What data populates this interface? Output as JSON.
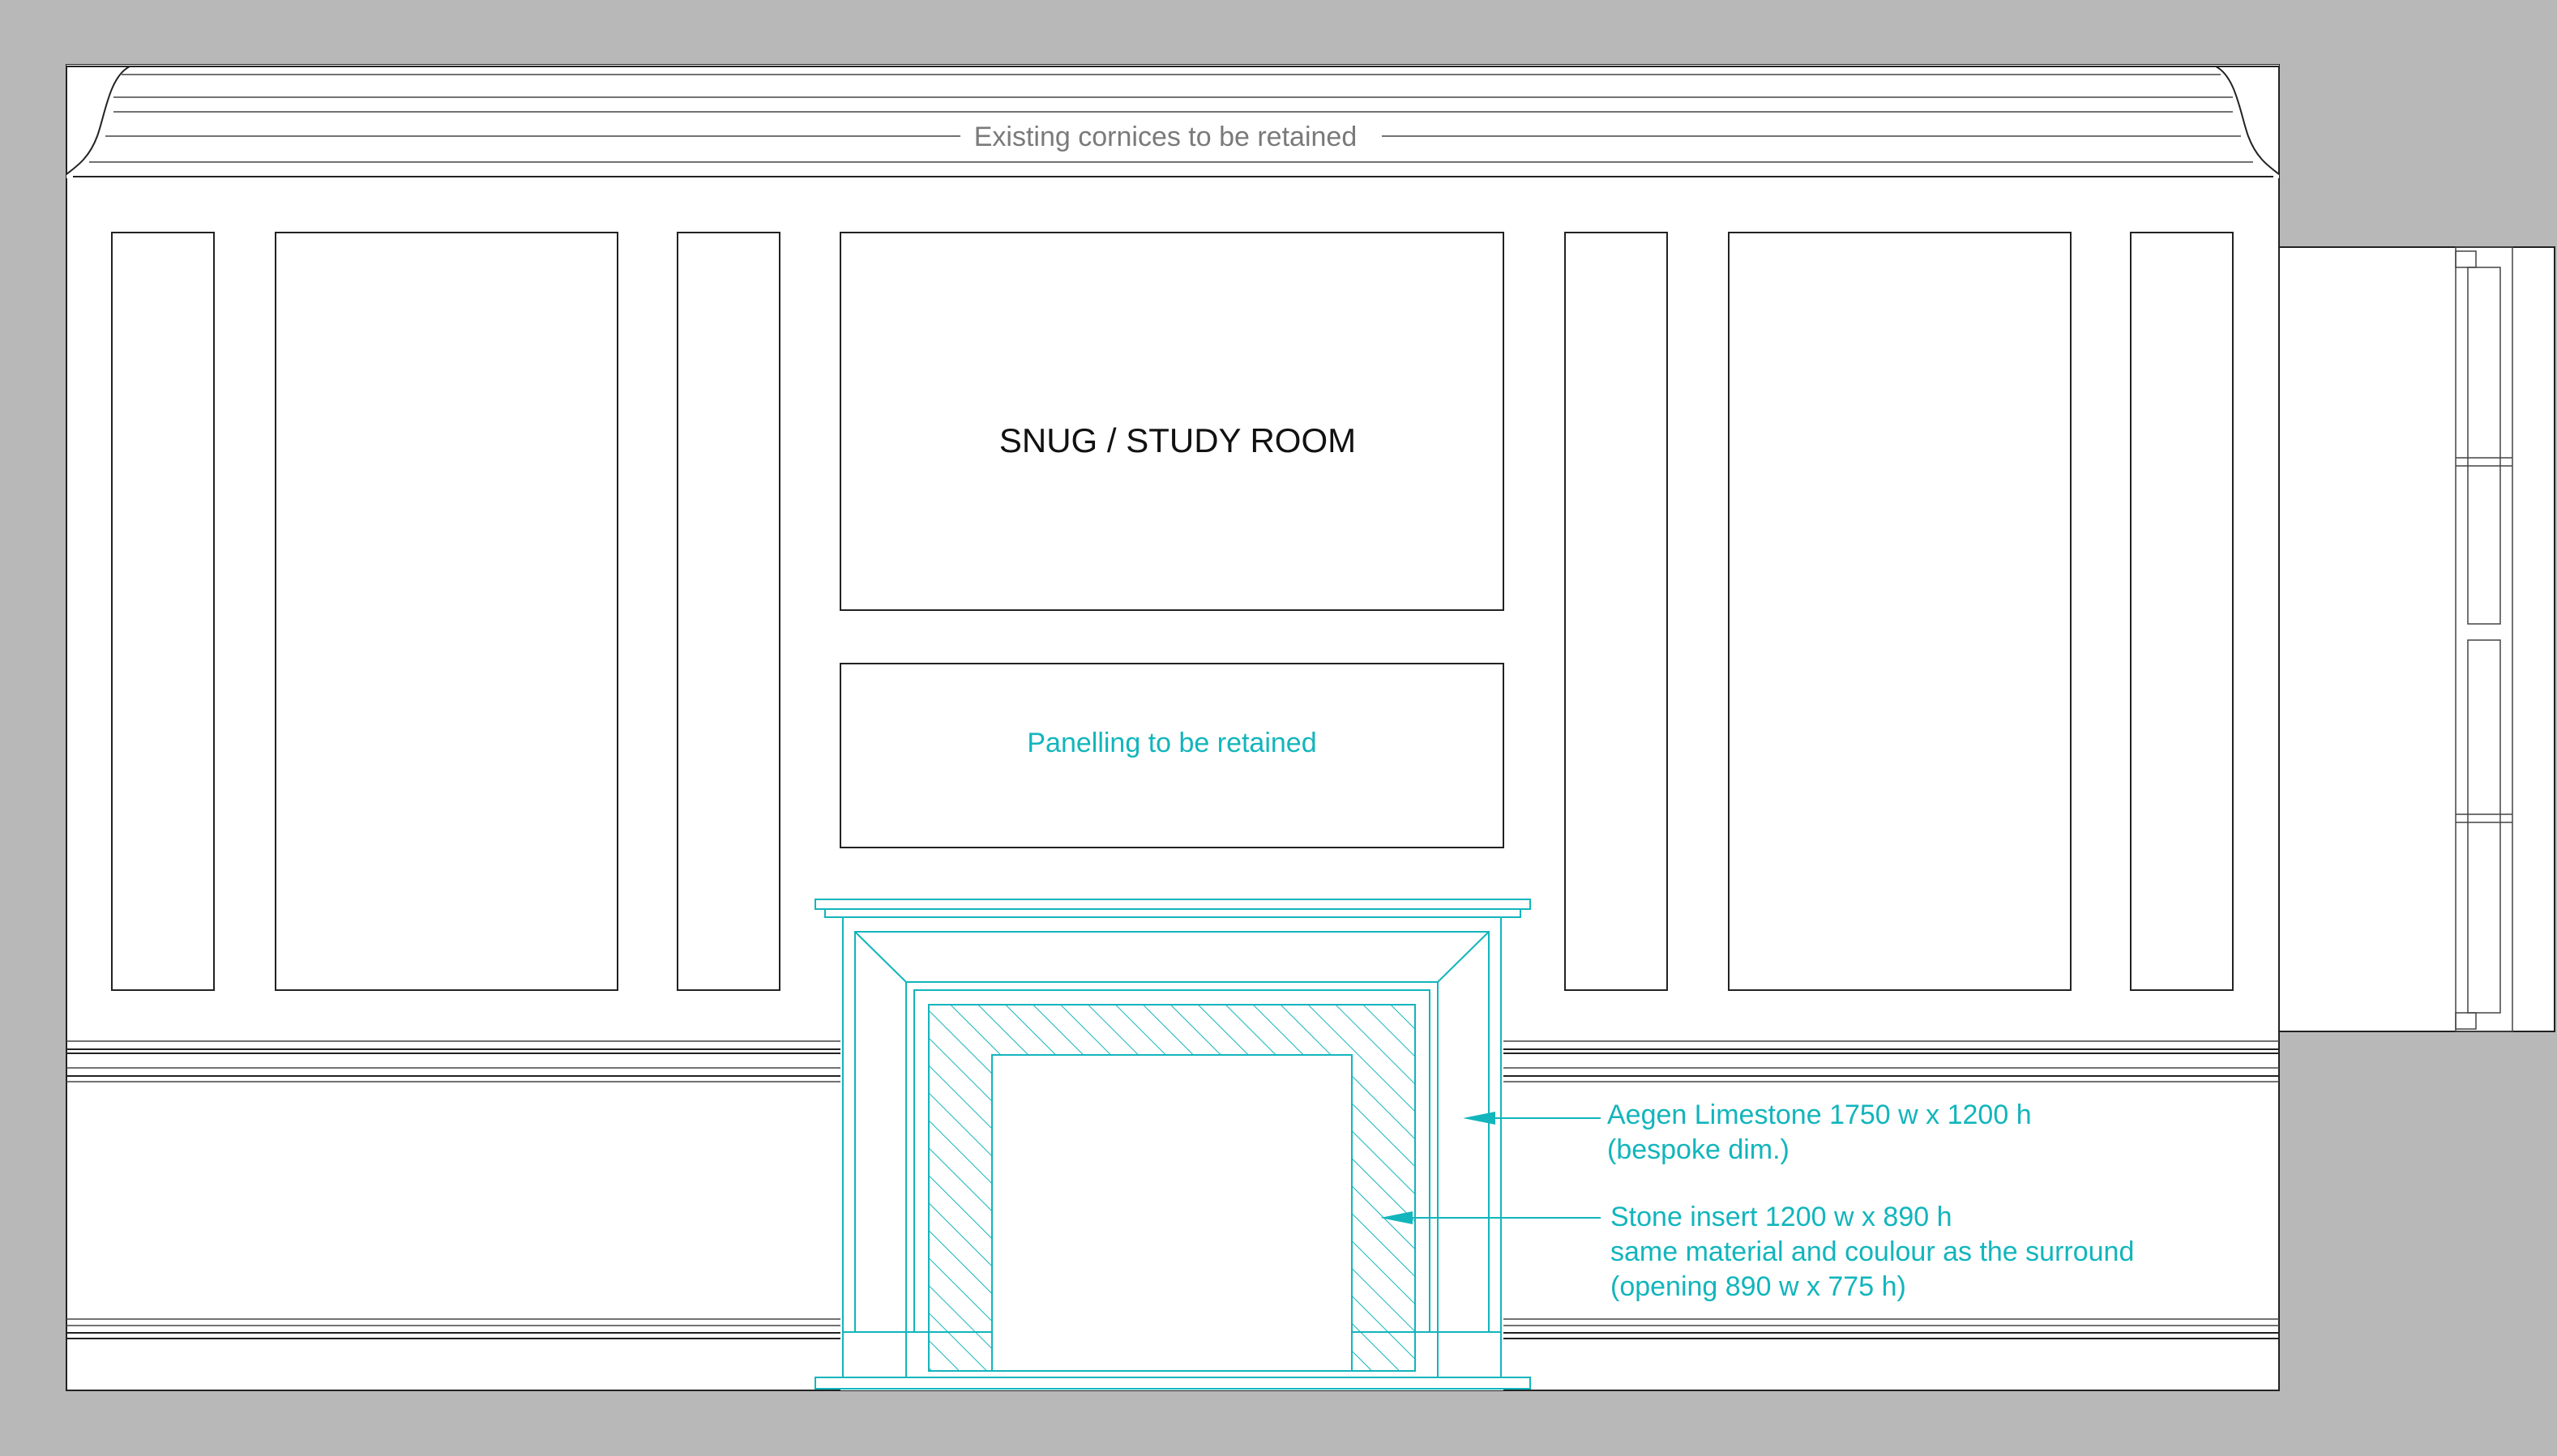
{
  "drawing": {
    "room_title": "SNUG / STUDY ROOM",
    "cornice_note": "Existing cornices to be retained",
    "panelling_note": "Panelling to be retained",
    "limestone_note_line1": "Aegen Limestone 1750 w x 1200 h",
    "limestone_note_line2": "(bespoke dim.)",
    "insert_note_line1": "Stone insert 1200 w x 890 h",
    "insert_note_line2": "same material and coulour as the surround",
    "insert_note_line3": "(opening 890 w x 775 h)"
  },
  "colors": {
    "background_gray": "#b8b8b8",
    "wall": "#ffffff",
    "line": "#222222",
    "annotation_cyan": "#12b5bc",
    "note_gray": "#7a7a7a"
  }
}
